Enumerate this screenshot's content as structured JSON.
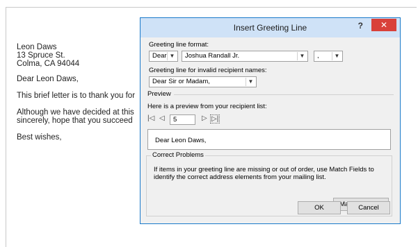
{
  "letter": {
    "name": "Leon Daws",
    "street": "13 Spruce St.",
    "city": "Colma, CA 94044",
    "salutation": "Dear Leon Daws,",
    "para1": "This brief letter is to thank you for",
    "para2_line1": "Although we have decided at this",
    "para2_line2": "sincerely, hope that you succeed",
    "closing": "Best wishes,"
  },
  "dialog": {
    "title": "Insert Greeting Line",
    "help": "?",
    "close": "✕",
    "format_label": "Greeting line format:",
    "salutation_value": "Dear",
    "name_format_value": "Joshua Randall Jr.",
    "punctuation_value": ",",
    "invalid_label": "Greeting line for invalid recipient names:",
    "invalid_value": "Dear Sir or Madam,",
    "preview_label": "Preview",
    "preview_sublabel": "Here is a preview from your recipient list:",
    "record_number": "5",
    "preview_text": "Dear Leon Daws,",
    "correct_title": "Correct Problems",
    "correct_text": "If items in your greeting line are missing or out of order, use Match Fields to identify the correct address elements from your mailing list.",
    "match_fields": "Match Fields...",
    "ok": "OK",
    "cancel": "Cancel"
  }
}
